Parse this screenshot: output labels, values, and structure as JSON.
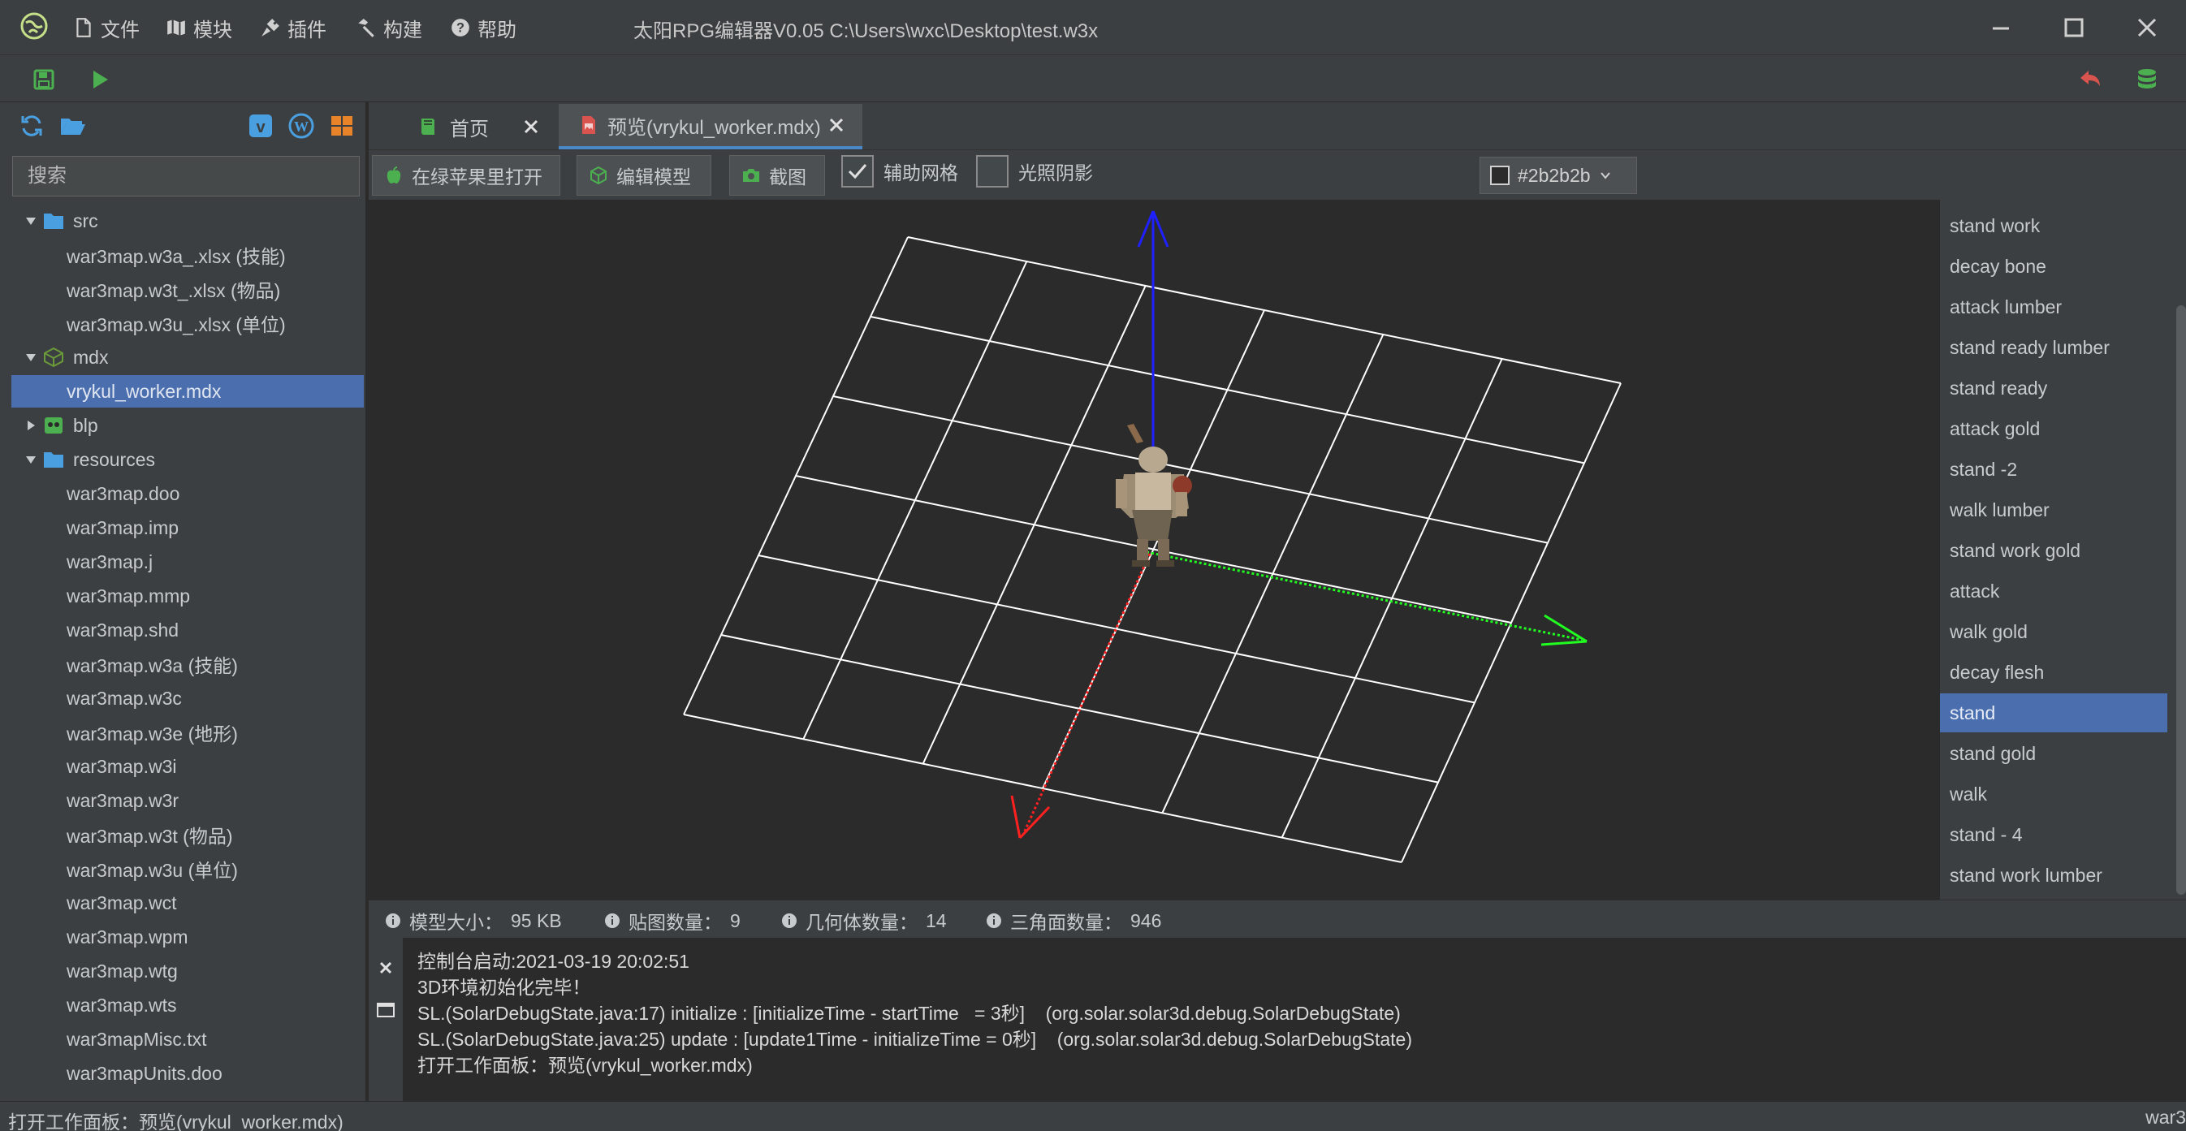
{
  "colors": {
    "background": "#2b2b2b",
    "panel": "#3c3f41",
    "selection": "#4b6eaf",
    "accent_green": "#4caf50",
    "accent_red": "#d9534f",
    "axis_x": "#ff2020",
    "axis_y": "#20ff20",
    "axis_z": "#2020ff",
    "grid": "#ffffff"
  },
  "menubar": {
    "logo_icon": "globe-logo-icon",
    "items": [
      {
        "label": "文件",
        "icon": "file-icon"
      },
      {
        "label": "模块",
        "icon": "map-icon"
      },
      {
        "label": "插件",
        "icon": "plug-icon"
      },
      {
        "label": "构建",
        "icon": "hammer-icon"
      },
      {
        "label": "帮助",
        "icon": "question-icon"
      }
    ],
    "title": "太阳RPG编辑器V0.05 C:\\Users\\wxc\\Desktop\\test.w3x",
    "window_buttons": [
      "minimize-icon",
      "maximize-icon",
      "close-icon"
    ]
  },
  "toolbar": {
    "left_icons": [
      "save-icon",
      "run-icon"
    ],
    "right_icons": [
      "undo-icon",
      "database-icon"
    ]
  },
  "sidebar": {
    "tool_icons": [
      "refresh-icon",
      "open-folder-icon",
      "vimeo-icon",
      "wordpress-icon",
      "windows-icon"
    ],
    "search_placeholder": "搜索",
    "tree": [
      {
        "label": "src",
        "type": "folder",
        "expanded": true,
        "level": 0
      },
      {
        "label": "war3map.w3a_.xlsx (技能)",
        "type": "file",
        "level": 1
      },
      {
        "label": "war3map.w3t_.xlsx (物品)",
        "type": "file",
        "level": 1
      },
      {
        "label": "war3map.w3u_.xlsx (单位)",
        "type": "file",
        "level": 1
      },
      {
        "label": "mdx",
        "type": "mdx-folder",
        "expanded": true,
        "level": 0
      },
      {
        "label": "vrykul_worker.mdx",
        "type": "file",
        "level": 1,
        "selected": true
      },
      {
        "label": "blp",
        "type": "blp-folder",
        "expanded": false,
        "level": 0
      },
      {
        "label": "resources",
        "type": "folder",
        "expanded": true,
        "level": 0
      },
      {
        "label": "war3map.doo",
        "type": "file",
        "level": 1
      },
      {
        "label": "war3map.imp",
        "type": "file",
        "level": 1
      },
      {
        "label": "war3map.j",
        "type": "file",
        "level": 1
      },
      {
        "label": "war3map.mmp",
        "type": "file",
        "level": 1
      },
      {
        "label": "war3map.shd",
        "type": "file",
        "level": 1
      },
      {
        "label": "war3map.w3a (技能)",
        "type": "file",
        "level": 1
      },
      {
        "label": "war3map.w3c",
        "type": "file",
        "level": 1
      },
      {
        "label": "war3map.w3e (地形)",
        "type": "file",
        "level": 1
      },
      {
        "label": "war3map.w3i",
        "type": "file",
        "level": 1
      },
      {
        "label": "war3map.w3r",
        "type": "file",
        "level": 1
      },
      {
        "label": "war3map.w3t (物品)",
        "type": "file",
        "level": 1
      },
      {
        "label": "war3map.w3u (单位)",
        "type": "file",
        "level": 1
      },
      {
        "label": "war3map.wct",
        "type": "file",
        "level": 1
      },
      {
        "label": "war3map.wpm",
        "type": "file",
        "level": 1
      },
      {
        "label": "war3map.wtg",
        "type": "file",
        "level": 1
      },
      {
        "label": "war3map.wts",
        "type": "file",
        "level": 1
      },
      {
        "label": "war3mapMisc.txt",
        "type": "file",
        "level": 1
      },
      {
        "label": "war3mapUnits.doo",
        "type": "file",
        "level": 1
      }
    ]
  },
  "tabs": [
    {
      "label": "首页",
      "icon": "book-icon",
      "active": false
    },
    {
      "label": "预览(vrykul_worker.mdx)",
      "icon": "image-file-icon",
      "active": true
    }
  ],
  "viewer_toolbar": {
    "open_in_apple_label": "在绿苹果里打开",
    "edit_model_label": "编辑模型",
    "screenshot_label": "截图",
    "grid_label": "辅助网格",
    "grid_checked": true,
    "shadow_label": "光照阴影",
    "shadow_checked": false,
    "bg_color_label": "#2b2b2b"
  },
  "animations": {
    "items": [
      "stand work",
      "decay bone",
      "attack lumber",
      "stand ready lumber",
      "stand ready",
      "attack gold",
      "stand -2",
      "walk lumber",
      "stand work gold",
      "attack",
      "walk gold",
      "decay flesh",
      "stand",
      "stand gold",
      "walk",
      "stand - 4",
      "stand work lumber"
    ],
    "selected": "stand"
  },
  "stats": {
    "model_size_label": "模型大小：",
    "model_size_value": "95 KB",
    "texture_count_label": "贴图数量：",
    "texture_count_value": "9",
    "geoset_count_label": "几何体数量：",
    "geoset_count_value": "14",
    "triangle_count_label": "三角面数量：",
    "triangle_count_value": "946"
  },
  "console": {
    "lines": [
      "控制台启动:2021-03-19 20:02:51",
      "3D环境初始化完毕！",
      "SL.(SolarDebugState.java:17) initialize : [initializeTime - startTime   = 3秒]    (org.solar.solar3d.debug.SolarDebugState)",
      "SL.(SolarDebugState.java:25) update : [update1Time - initializeTime = 0秒]    (org.solar.solar3d.debug.SolarDebugState)",
      "打开工作面板：预览(vrykul_worker.mdx)"
    ]
  },
  "statusbar": {
    "left": "打开工作面板：预览(vrykul_worker.mdx)",
    "right": "war3"
  }
}
